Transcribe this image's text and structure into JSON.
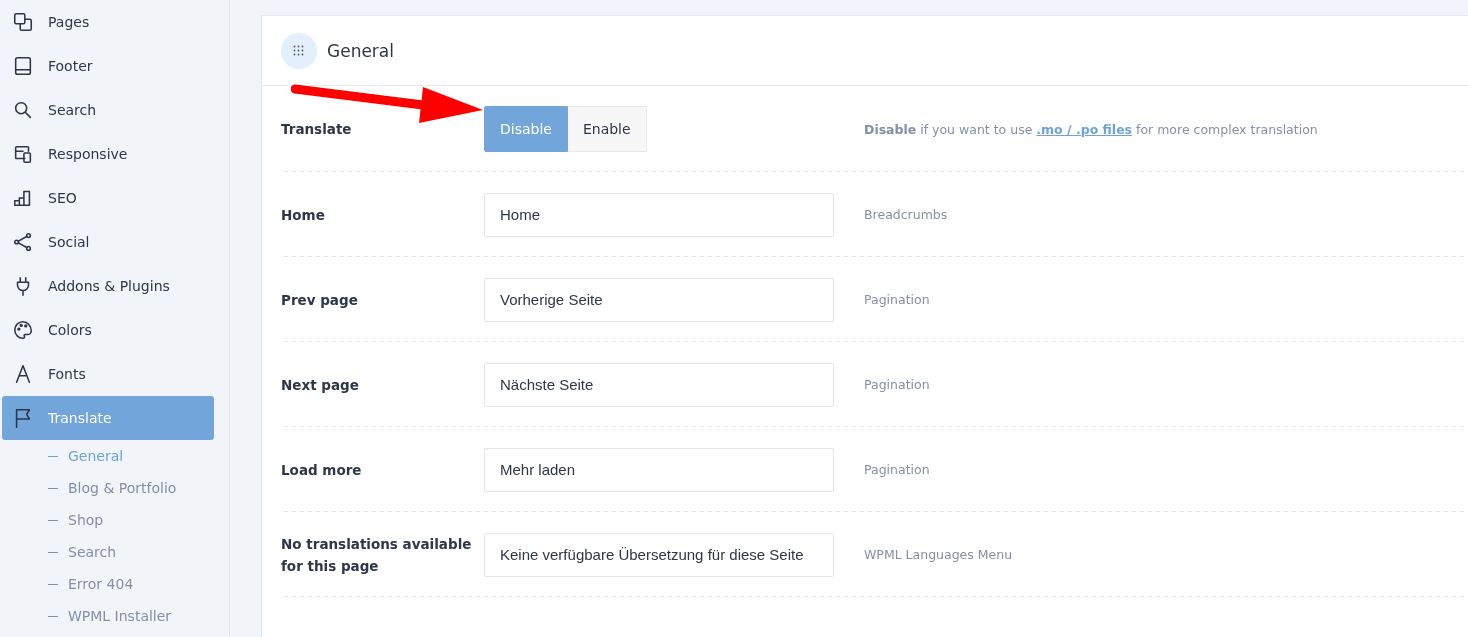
{
  "sidebar": {
    "items": [
      {
        "label": "Pages",
        "selected": false
      },
      {
        "label": "Footer",
        "selected": false
      },
      {
        "label": "Search",
        "selected": false
      },
      {
        "label": "Responsive",
        "selected": false
      },
      {
        "label": "SEO",
        "selected": false
      },
      {
        "label": "Social",
        "selected": false
      },
      {
        "label": "Addons & Plugins",
        "selected": false
      },
      {
        "label": "Colors",
        "selected": false
      },
      {
        "label": "Fonts",
        "selected": false
      },
      {
        "label": "Translate",
        "selected": true,
        "children": [
          {
            "label": "General",
            "selected": true
          },
          {
            "label": "Blog & Portfolio",
            "selected": false
          },
          {
            "label": "Shop",
            "selected": false
          },
          {
            "label": "Search",
            "selected": false
          },
          {
            "label": "Error 404",
            "selected": false
          },
          {
            "label": "WPML Installer",
            "selected": false
          }
        ]
      }
    ]
  },
  "panel": {
    "title": "General",
    "rows": [
      {
        "kind": "toggle",
        "label": "Translate",
        "options": [
          {
            "label": "Disable",
            "selected": true
          },
          {
            "label": "Enable",
            "selected": false
          }
        ],
        "hint": "**Disable** if you want to use",
        "hint_link": ".mo / .po files",
        "hint_end": "for more complex translation"
      },
      {
        "kind": "text",
        "label": "Home",
        "value": "Home",
        "hint": "Breadcrumbs"
      },
      {
        "kind": "text",
        "label": "Prev page",
        "value": "Vorherige Seite",
        "hint": "Pagination"
      },
      {
        "kind": "text",
        "label": "Next page",
        "value": "Nächste Seite",
        "hint": "Pagination"
      },
      {
        "kind": "text",
        "label": "Load more",
        "value": "Mehr laden",
        "hint": "Pagination"
      },
      {
        "kind": "text",
        "label": "No translations available for this page",
        "value": "Keine verfügbare Übersetzung für diese Seite",
        "hint": "WPML Languages Menu"
      }
    ]
  }
}
